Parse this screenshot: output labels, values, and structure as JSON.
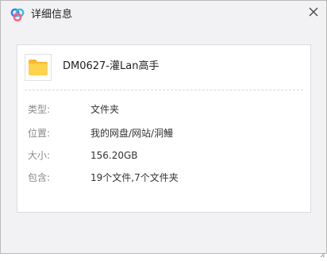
{
  "window": {
    "title": "详细信息",
    "icons": {
      "logo": "baidu-netdisk-logo-icon",
      "close": "close-icon",
      "file": "folder-icon"
    },
    "colors": {
      "logo_blue": "#2f7bff",
      "logo_teal": "#38c3d8",
      "logo_pink": "#ff5c8a",
      "folder_yellow": "#ffd24c"
    }
  },
  "file": {
    "name": "DM0627-灌Lan高手"
  },
  "details": {
    "type": {
      "label": "类型:",
      "value": "文件夹"
    },
    "location": {
      "label": "位置:",
      "value": "我的网盘/网站/洞鰻"
    },
    "size": {
      "label": "大小:",
      "value": "156.20GB"
    },
    "contents": {
      "label": "包含:",
      "value": "19个文件,7个文件夹"
    }
  }
}
